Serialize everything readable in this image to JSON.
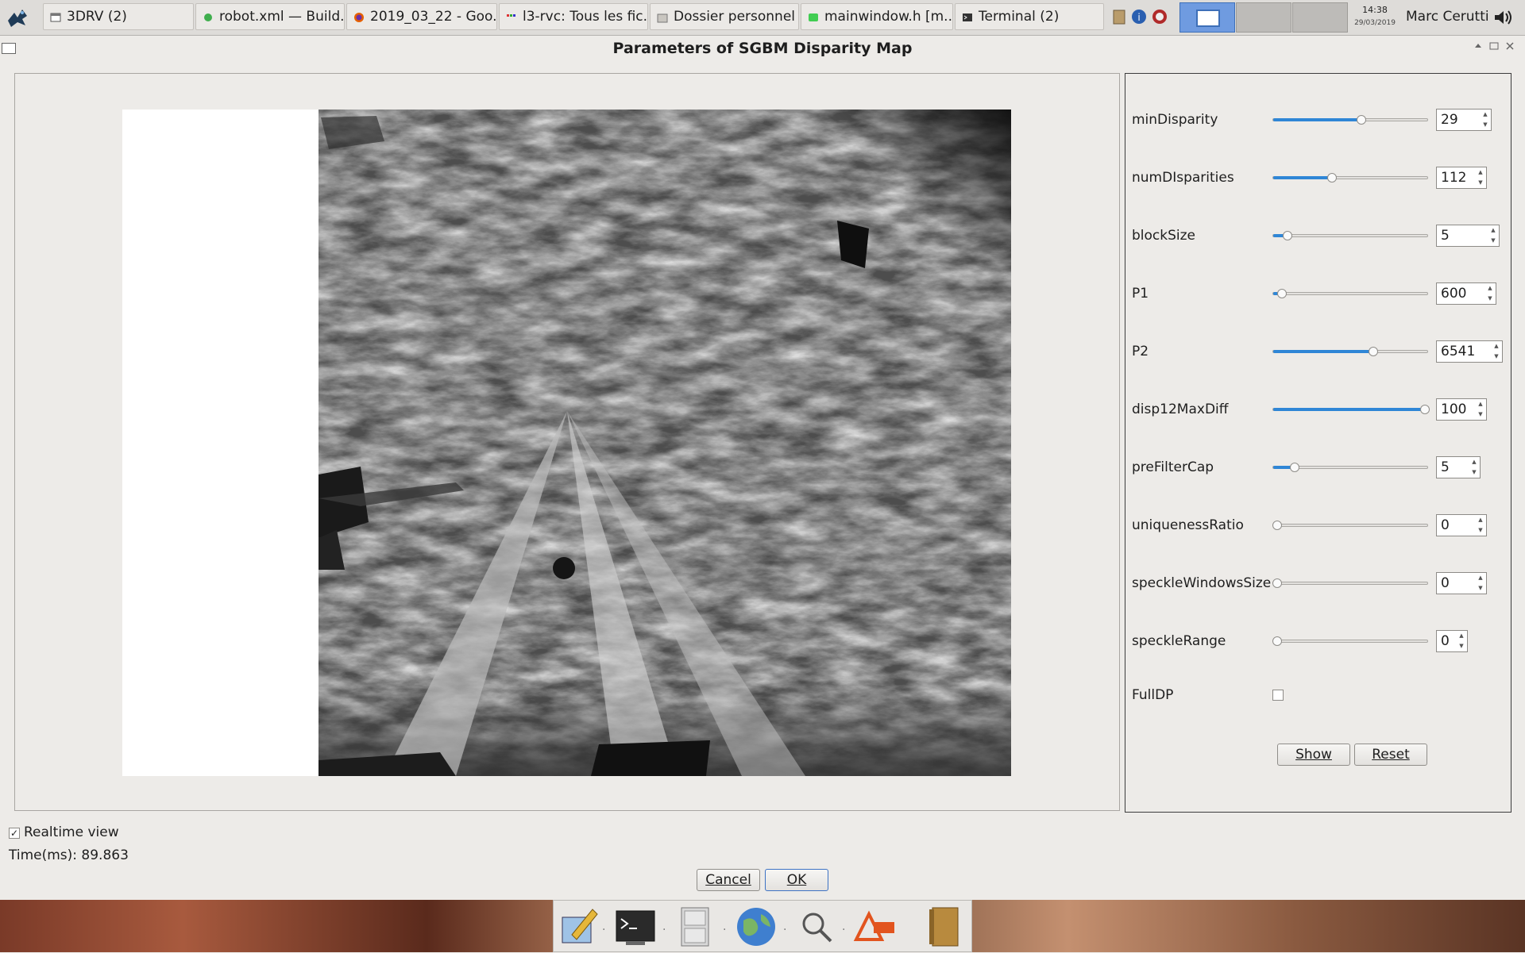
{
  "taskbar": {
    "tasks": [
      {
        "label": "3DRV (2)",
        "icon": "window-icon"
      },
      {
        "label": "robot.xml — Build...",
        "icon": "green-dot-icon"
      },
      {
        "label": "2019_03_22 - Goo...",
        "icon": "firefox-icon"
      },
      {
        "label": "l3-rvc: Tous les fic...",
        "icon": "browser-tab-icon"
      },
      {
        "label": "Dossier personnel",
        "icon": "folder-icon"
      },
      {
        "label": "mainwindow.h [m...",
        "icon": "qtcreator-icon"
      },
      {
        "label": "Terminal (2)",
        "icon": "terminal-icon"
      }
    ],
    "clock_time": "14:38",
    "clock_date": "29/03/2019",
    "user": "Marc Cerutti"
  },
  "window": {
    "title": "Parameters of SGBM Disparity Map"
  },
  "params": [
    {
      "name": "minDisparity",
      "value": "29",
      "slider": 0.57
    },
    {
      "name": "numDIsparities",
      "value": "112",
      "slider": 0.37
    },
    {
      "name": "blockSize",
      "value": "5",
      "slider": 0.07
    },
    {
      "name": "P1",
      "value": "600",
      "slider": 0.03
    },
    {
      "name": "P2",
      "value": "6541",
      "slider": 0.65
    },
    {
      "name": "disp12MaxDiff",
      "value": "100",
      "slider": 1.0
    },
    {
      "name": "preFilterCap",
      "value": "5",
      "slider": 0.12
    },
    {
      "name": "uniquenessRatio",
      "value": "0",
      "slider": 0.0
    },
    {
      "name": "speckleWindowsSize",
      "value": "0",
      "slider": 0.0
    },
    {
      "name": "speckleRange",
      "value": "0",
      "slider": 0.0
    }
  ],
  "fulldp": {
    "label": "FullDP",
    "checked": false
  },
  "buttons": {
    "show": "Show",
    "reset": "Reset",
    "cancel": "Cancel",
    "ok": "OK"
  },
  "realtime": {
    "label": "Realtime view",
    "checked": true
  },
  "time_text": "Time(ms): 89.863",
  "colors": {
    "accent": "#2f86d6",
    "panel_bg": "#edebe8"
  }
}
